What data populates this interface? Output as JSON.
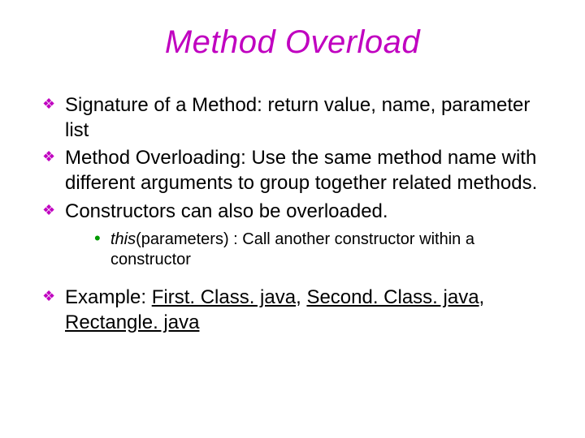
{
  "title": "Method Overload",
  "bullets": {
    "b1": "Signature of a Method: return value, name, parameter list",
    "b2": "Method Overloading: Use the same method name with different arguments to group together related methods.",
    "b3": "Constructors can also be overloaded.",
    "sub1_this": "this",
    "sub1_rest": "(parameters) : Call another constructor within a constructor",
    "b4_lead": "Example: ",
    "b4_link1": "First. Class. java",
    "b4_sep": ", ",
    "b4_link2": "Second. Class. java",
    "b4_link3": "Rectangle. java"
  }
}
